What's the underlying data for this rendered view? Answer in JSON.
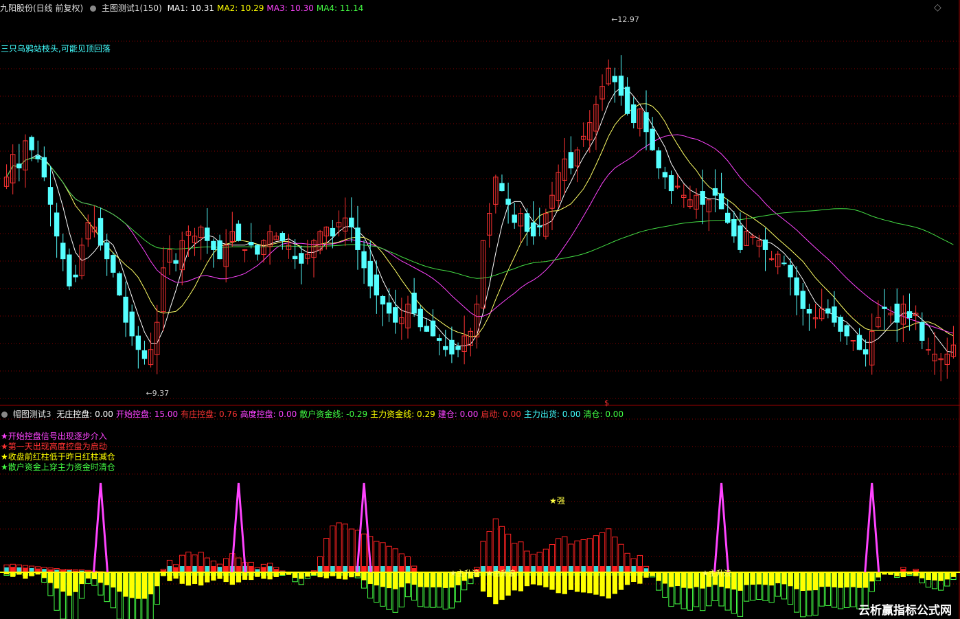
{
  "main_header": {
    "stock": "九阳股份(日线 前复权)",
    "indicator": "主图测试1(150)",
    "items": [
      {
        "label": "MA1: 10.31",
        "color": "#ffffff"
      },
      {
        "label": "MA2: 10.29",
        "color": "#ffff00"
      },
      {
        "label": "MA3: 10.30",
        "color": "#ff44ff"
      },
      {
        "label": "MA4: 11.14",
        "color": "#44ff44"
      }
    ]
  },
  "main_note": "三只乌鸦站枝头,可能见顶回落",
  "sub_header": {
    "indicator": "帽图测试3",
    "items": [
      {
        "label": "无庄控盘: 0.00",
        "color": "#ffffff"
      },
      {
        "label": "开始控盘: 15.00",
        "color": "#ff44ff"
      },
      {
        "label": "有庄控盘: 0.76",
        "color": "#ff3333"
      },
      {
        "label": "高度控盘: 0.00",
        "color": "#ff44ff"
      },
      {
        "label": "散户资金线: -0.29",
        "color": "#44ff44"
      },
      {
        "label": "主力资金线: 0.29",
        "color": "#ffff00"
      },
      {
        "label": "建仓: 0.00",
        "color": "#ff44ff"
      },
      {
        "label": "启动: 0.00",
        "color": "#ff3333"
      },
      {
        "label": "主力出货: 0.00",
        "color": "#44ffff"
      },
      {
        "label": "清仓: 0.00",
        "color": "#44ff44"
      }
    ]
  },
  "legend_notes": [
    {
      "text": "★开始控盘信号出现逐步介入",
      "color": "#ff44ff"
    },
    {
      "text": "★第一天出现高度控盘为启动",
      "color": "#ff3333"
    },
    {
      "text": "★收盘前红柱低于昨日红柱减仓",
      "color": "#ffff00"
    },
    {
      "text": "★散户资金上穿主力资金时清仓",
      "color": "#44ff44"
    }
  ],
  "watermark": "云析赢指标公式网",
  "colors": {
    "up": "#ff3333",
    "down": "#55ffff",
    "ma1": "#ffffff",
    "ma2": "#ffff66",
    "ma3": "#ff44ff",
    "ma4": "#44dd44",
    "grid": "#8b0000"
  },
  "chart_data": {
    "type": "candlestick",
    "price_range": [
      9.0,
      13.3
    ],
    "high_label": "12.97",
    "low_label": "9.37",
    "dollar_mark": "$",
    "star_label": "★强",
    "signals": [
      "★主升浪",
      "★主升浪",
      "★主升浪"
    ],
    "closes": [
      11.5,
      11.75,
      11.6,
      11.9,
      11.8,
      11.7,
      11.5,
      11.2,
      10.85,
      10.6,
      10.3,
      10.4,
      10.75,
      11.0,
      10.95,
      10.75,
      10.6,
      10.45,
      10.2,
      9.9,
      9.75,
      9.6,
      9.5,
      9.6,
      9.9,
      10.5,
      10.7,
      10.55,
      10.8,
      10.9,
      10.85,
      10.95,
      10.8,
      10.7,
      10.6,
      10.75,
      10.9,
      10.8,
      10.7,
      10.75,
      10.65,
      10.8,
      10.9,
      10.85,
      10.8,
      10.75,
      10.6,
      10.55,
      10.65,
      10.8,
      10.9,
      10.95,
      10.85,
      11.0,
      11.05,
      10.95,
      10.7,
      10.5,
      10.3,
      10.2,
      10.1,
      10.0,
      9.9,
      9.95,
      10.1,
      10.0,
      9.85,
      9.8,
      9.75,
      9.7,
      9.6,
      9.55,
      9.6,
      9.75,
      9.8,
      10.1,
      10.8,
      11.1,
      11.5,
      11.35,
      11.2,
      11.0,
      11.1,
      10.9,
      10.85,
      10.95,
      11.1,
      11.3,
      11.55,
      11.7,
      11.6,
      11.8,
      11.95,
      12.1,
      12.3,
      12.5,
      12.7,
      12.55,
      12.4,
      12.2,
      12.1,
      12.25,
      12.0,
      11.8,
      11.6,
      11.5,
      11.35,
      11.4,
      11.3,
      11.25,
      11.3,
      11.2,
      11.25,
      11.3,
      11.15,
      11.0,
      10.85,
      10.7,
      10.9,
      10.85,
      10.8,
      10.7,
      10.6,
      10.65,
      10.55,
      10.4,
      10.2,
      10.05,
      10.0,
      9.95,
      10.05,
      10.0,
      9.9,
      9.8,
      9.75,
      9.7,
      9.6,
      9.55,
      9.8,
      9.95,
      10.05,
      10.0,
      9.9,
      10.1,
      9.95,
      10.0,
      9.7,
      9.6,
      9.55,
      9.5,
      9.55,
      9.65
    ],
    "vol_range": [
      -1.0,
      1.2
    ],
    "sub_spikes": [
      40,
      98,
      151,
      301,
      365
    ],
    "red_bars": [
      0.12,
      0.13,
      0.12,
      0.11,
      0.1,
      0.09,
      0.08,
      0.07,
      0.06,
      0.05,
      0.05,
      0.04,
      0.04,
      0.03,
      0.02,
      0.01,
      0.0,
      0.0,
      0.0,
      0.0,
      0.0,
      0.0,
      0.0,
      0.0,
      0.0,
      0.0,
      0.0,
      0.0,
      0.0,
      0.0,
      0.0,
      0.0,
      0.0,
      0.0,
      0.0,
      0.0,
      0.0,
      0.0,
      0.0,
      0.0,
      0.0,
      0.0,
      0.0,
      0.0,
      0.0,
      0.0,
      0.0,
      0.0,
      0.0,
      0.0,
      0.25,
      0.55,
      0.75,
      0.8,
      0.78,
      0.7,
      0.68,
      0.62,
      0.58,
      0.5,
      0.48,
      0.42,
      0.38,
      0.3,
      0.25,
      0.1,
      0.0,
      0.0,
      0.0,
      0.0,
      0.0,
      0.0,
      0.0,
      0.0,
      0.0,
      0.0,
      0.0,
      0.0,
      0.0,
      0.0,
      0.0,
      0.0,
      0.0,
      0.0,
      0.0,
      0.0,
      0.0,
      0.0,
      0.0,
      0.0,
      0.0,
      0.0,
      0.0,
      0.0,
      0.0,
      0.0,
      0.0,
      0.0,
      0.0,
      0.0,
      0.0,
      0.0,
      0.0,
      0.0,
      0.0,
      0.0,
      0.0,
      0.0,
      0.0,
      0.0,
      0.0,
      0.0,
      0.0,
      0.0,
      0.0,
      0.0,
      0.0,
      0.0,
      0.0,
      0.0,
      0.0,
      0.0,
      0.0,
      0.0,
      0.0,
      0.0,
      0.0,
      0.0,
      0.0,
      0.0,
      0.0,
      0.0,
      0.0,
      0.0,
      0.0,
      0.0,
      0.0,
      0.0,
      0.0,
      0.0,
      0.0,
      0.0,
      0.0,
      0.0,
      0.0,
      0.0,
      0.0,
      0.0,
      0.0,
      0.0,
      0.0,
      0.0,
      0.0,
      0.0,
      0.0,
      0.0
    ]
  }
}
